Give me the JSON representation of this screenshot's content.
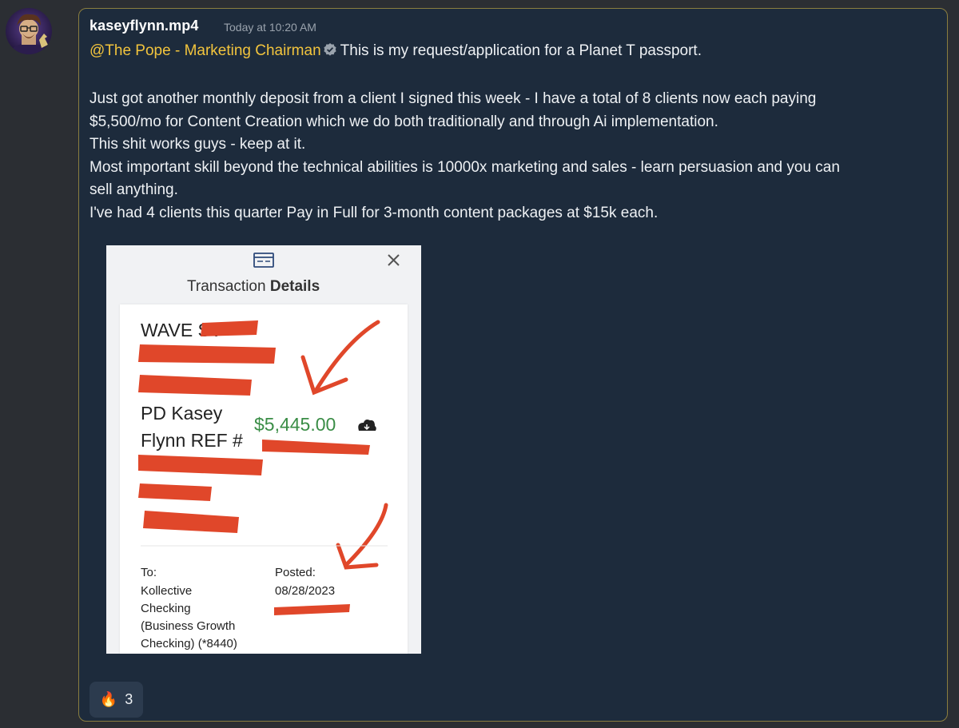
{
  "message": {
    "username": "kaseyflynn.mp4",
    "timestamp": "Today at 10:20 AM",
    "mention": "@The Pope - Marketing Chairman",
    "intro": "This is my request/application for a Planet T passport.",
    "lines": [
      "Just got another monthly deposit from a client I signed this week - I have a total of 8 clients now each paying",
      "$5,500/mo for Content Creation which we do both traditionally and through Ai implementation.",
      "This shit works guys - keep at it.",
      "Most important skill beyond the technical abilities is 10000x marketing and sales - learn persuasion and you can",
      "sell anything.",
      "I've had 4 clients this quarter Pay in Full for 3-month content packages at $15k each."
    ]
  },
  "receipt": {
    "header_icon": "receipt-card-icon",
    "close_icon": "close-icon",
    "title_light": "Transaction",
    "title_bold": "Details",
    "line_wave": "WAVE SV",
    "line_pd": "PD Kasey",
    "line_ref": "Flynn REF #",
    "amount": "$5,445.00",
    "amount_color": "#3a8d46",
    "download_icon": "cloud-download-icon",
    "to_label": "To:",
    "to_lines": [
      "Kollective",
      "Checking",
      "(Business Growth",
      "Checking) (*8440)"
    ],
    "posted_label": "Posted:",
    "posted_date": "08/28/2023",
    "redaction_color": "#e0472a"
  },
  "reaction": {
    "emoji": "🔥",
    "emoji_icon": "fire-icon",
    "count": "3"
  },
  "colors": {
    "message_bg": "#1d2b3c",
    "highlight_border": "#8b7e3f",
    "mention": "#f2c43d",
    "page_bg": "#2b2e33"
  }
}
